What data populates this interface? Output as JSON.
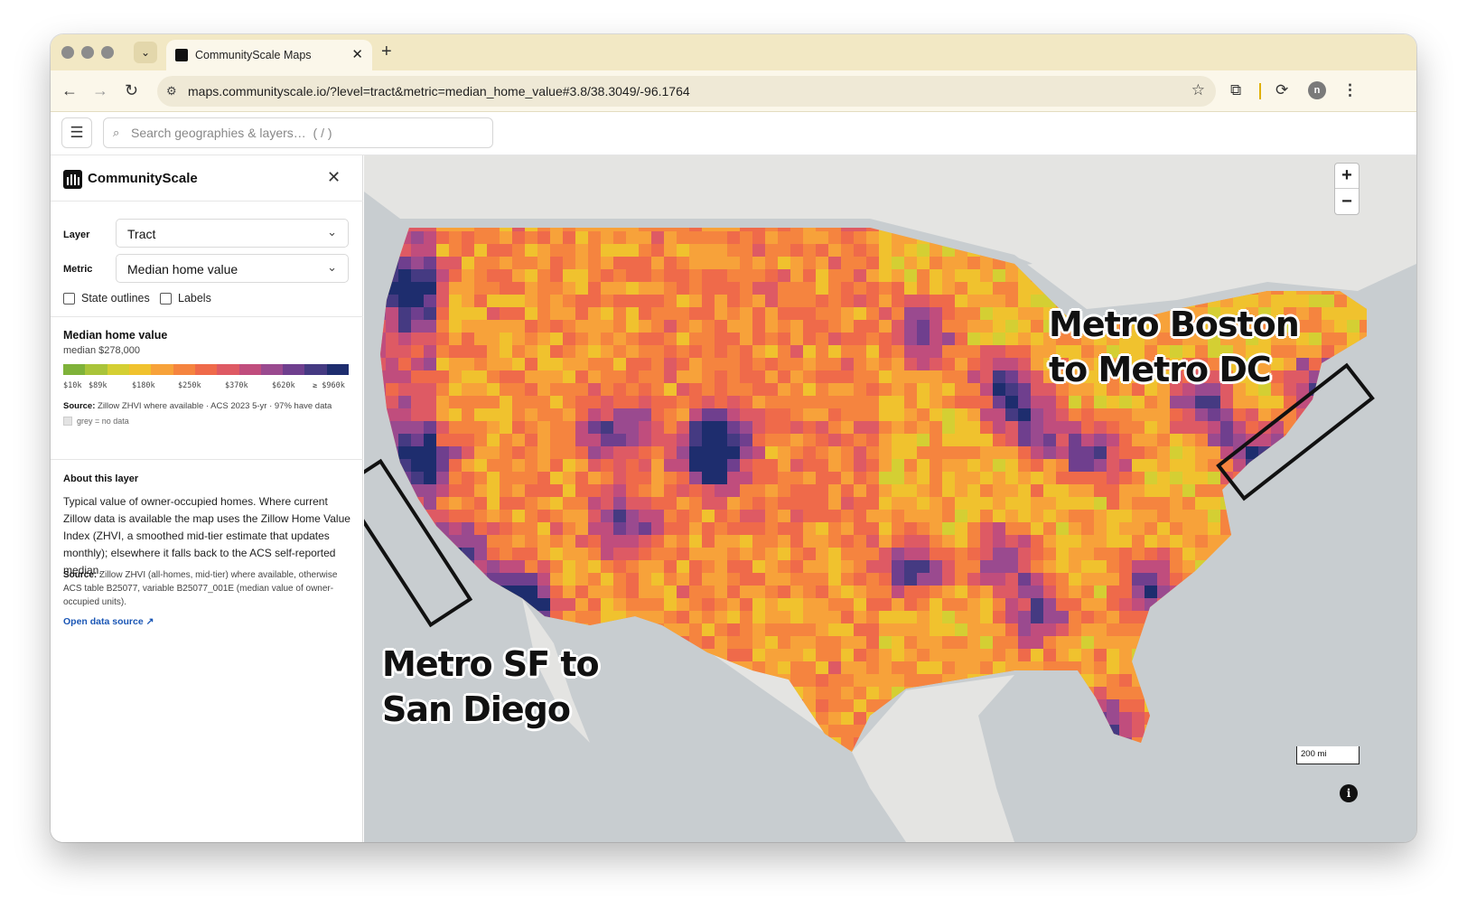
{
  "browser": {
    "tab_title": "CommunityScale Maps",
    "new_tab_label": "+",
    "url": "maps.communityscale.io/?level=tract&metric=median_home_value#3.8/38.3049/-96.1764"
  },
  "app": {
    "search_placeholder": "Search geographies & layers…  ( / )"
  },
  "panel": {
    "brand": "CommunityScale",
    "layer_label": "Layer",
    "layer_value": "Tract",
    "metric_label": "Metric",
    "metric_value": "Median home value",
    "checkboxes": [
      {
        "label": "State outlines",
        "checked": false
      },
      {
        "label": "Labels",
        "checked": false
      }
    ]
  },
  "legend": {
    "title": "Median home value",
    "subtitle": "median $278,000",
    "colors": [
      "#7fb23a",
      "#a9c43a",
      "#d4cf33",
      "#f0c22e",
      "#f7a23a",
      "#f5843f",
      "#ef6a4a",
      "#de5a64",
      "#c04d7d",
      "#9a4a8f",
      "#6f3f8e",
      "#453a82",
      "#1e2d6e"
    ],
    "ticks": [
      "$10k",
      "$89k",
      "$180k",
      "$250k",
      "$370k",
      "$620k",
      "≥ $960k"
    ],
    "source_label": "Source:",
    "source_text": "Zillow ZHVI where available · ACS 2023 5-yr · 97% have data",
    "no_data_text": "grey = no data"
  },
  "about": {
    "title": "About this layer",
    "body": "Typical value of owner-occupied homes. Where current Zillow data is available the map uses the Zillow Home Value Index (ZHVI, a smoothed mid-tier estimate that updates monthly); elsewhere it falls back to the ACS self-reported median.",
    "source_label": "Source:",
    "source_text": "Zillow ZHVI (all-homes, mid-tier) where available, otherwise ACS table B25077, variable B25077_001E (median value of owner-occupied units).",
    "link_text": "Open data source ↗"
  },
  "map": {
    "scale_label": "200 mi",
    "annotation_east": [
      "Metro Boston",
      "to Metro DC"
    ],
    "annotation_west": [
      "Metro SF to",
      "San Diego"
    ]
  },
  "colors": {
    "tabbar": "#f2e8c4",
    "toolbar": "#fbf7ea",
    "water": "#c8cdd0",
    "land": "#e4e4e2",
    "link": "#1a56b5"
  }
}
